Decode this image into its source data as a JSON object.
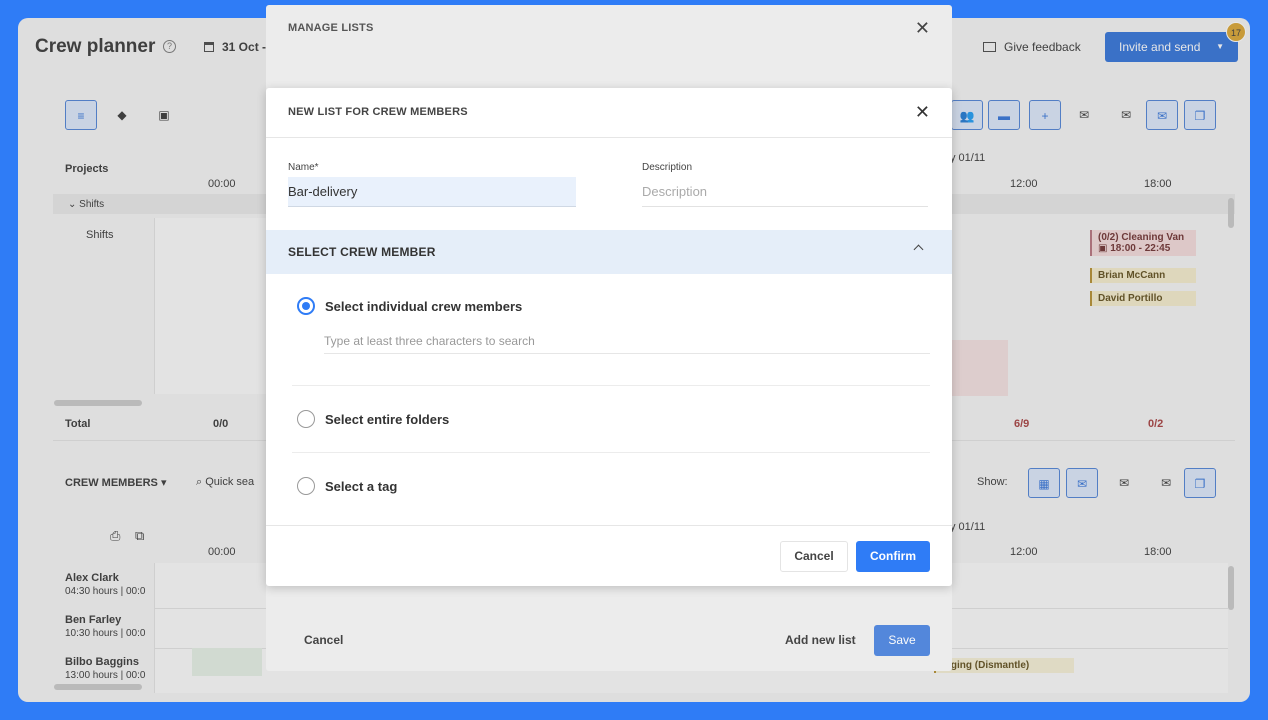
{
  "app": {
    "title": "Crew planner",
    "date": "31 Oct -",
    "feedback": "Give feedback",
    "invite_button": "Invite and send",
    "notification_count": "17",
    "projects_label": "Projects",
    "shifts_group": "Shifts",
    "shifts_row": "Shifts",
    "total_label": "Total",
    "crew_members_label": "CREW MEMBERS",
    "quick_search": "Quick sea",
    "show_label": "Show:",
    "date_right_top": "y 01/11",
    "date_right_bottom": "y 01/11",
    "times": [
      "00:00",
      "12:00",
      "18:00"
    ],
    "totals": [
      "0/0",
      "6/9",
      "0/2"
    ],
    "events": {
      "cleaning_van": "(0/2) Cleaning Van",
      "cleaning_van_time": "18:00 - 22:45",
      "brian": "Brian McCann",
      "david": "David Portillo",
      "rigging": "igging (Dismantle)"
    },
    "crew": [
      {
        "name": "Alex Clark",
        "hours": "04:30 hours | 00:0"
      },
      {
        "name": "Ben Farley",
        "hours": "10:30 hours | 00:0"
      },
      {
        "name": "Bilbo Baggins",
        "hours": "13:00 hours | 00:0"
      }
    ]
  },
  "manage_lists": {
    "title": "MANAGE LISTS",
    "cancel": "Cancel",
    "add_new_list": "Add new list",
    "save": "Save"
  },
  "modal": {
    "title": "NEW LIST FOR CREW MEMBERS",
    "name_label": "Name*",
    "name_value": "Bar-delivery",
    "description_label": "Description",
    "description_placeholder": "Description",
    "section_title": "SELECT CREW MEMBER",
    "option_individual": "Select individual crew members",
    "search_placeholder": "Type at least three characters to search",
    "option_folders": "Select entire folders",
    "option_tag": "Select a tag",
    "cancel": "Cancel",
    "confirm": "Confirm"
  },
  "colors": {
    "accent": "#2f7cf6",
    "invite_button": "#2d6fd8",
    "badge": "#d9a32c"
  }
}
